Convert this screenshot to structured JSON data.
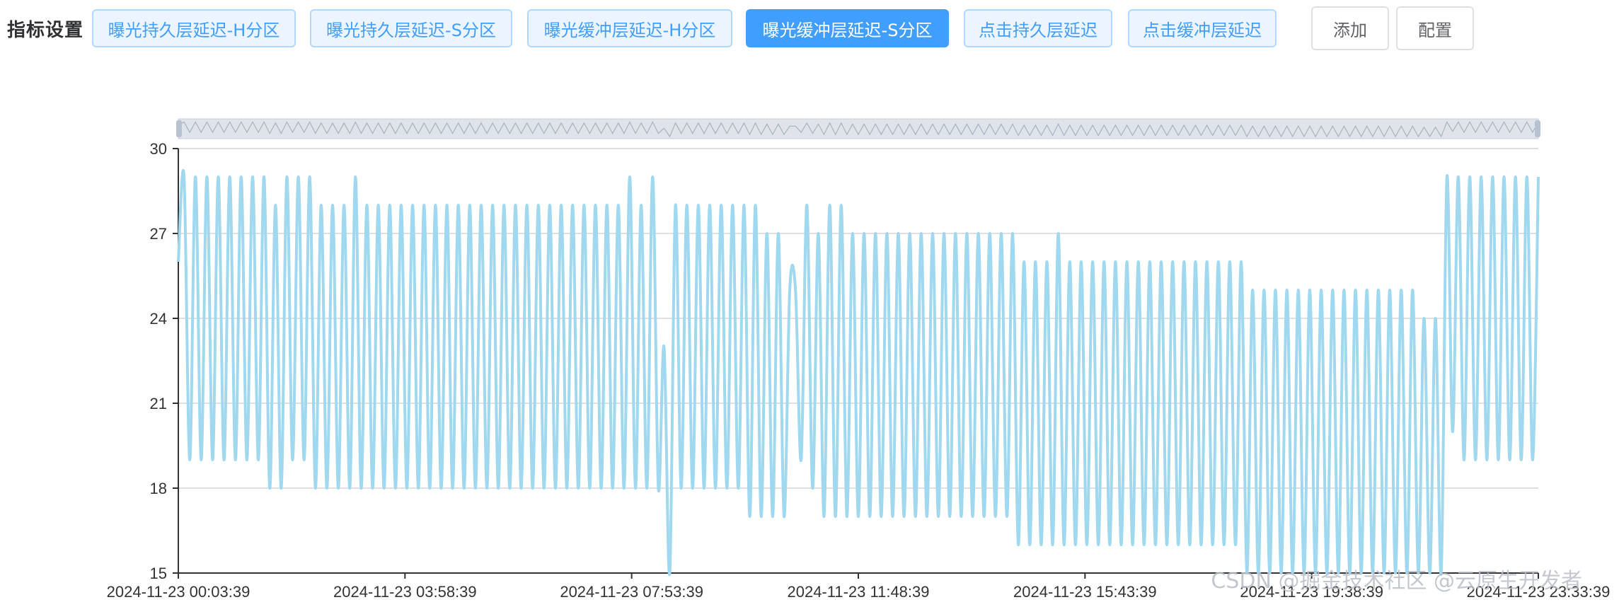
{
  "toolbar": {
    "label": "指标设置",
    "metric_buttons": [
      {
        "label": "曝光持久层延迟-H分区",
        "active": false
      },
      {
        "label": "曝光持久层延迟-S分区",
        "active": false
      },
      {
        "label": "曝光缓冲层延迟-H分区",
        "active": false
      },
      {
        "label": "曝光缓冲层延迟-S分区",
        "active": true
      },
      {
        "label": "点击持久层延迟",
        "active": false
      },
      {
        "label": "点击缓冲层延迟",
        "active": false
      }
    ],
    "add_label": "添加",
    "config_label": "配置"
  },
  "colors": {
    "accent": "#409eff",
    "series_line": "#9fd8ef",
    "grid": "#d3d6db",
    "axis": "#333333"
  },
  "watermark": "CSDN @掘金技术社区 @云原生开发者",
  "chart_data": {
    "type": "line",
    "title": "",
    "xlabel": "",
    "ylabel": "",
    "ylim": [
      15,
      30
    ],
    "yticks": [
      15,
      18,
      21,
      24,
      27,
      30
    ],
    "xticks": [
      "2024-11-23 00:03:39",
      "2024-11-23 03:58:39",
      "2024-11-23 07:53:39",
      "2024-11-23 11:48:39",
      "2024-11-23 15:43:39",
      "2024-11-23 19:38:39",
      "2024-11-23 23:33:39"
    ],
    "x_start": "2024-11-23 00:03:39",
    "x_end": "2024-11-23 23:33:39",
    "grid": true,
    "legend": "none",
    "datazoom_slider": true,
    "series": [
      {
        "values": [
          26,
          29,
          19,
          29,
          19,
          29,
          19,
          29,
          19,
          29,
          19,
          29,
          19,
          29,
          19,
          29,
          18,
          28,
          18,
          29,
          19,
          29,
          19,
          29,
          18,
          28,
          18,
          28,
          18,
          28,
          18,
          29,
          18,
          28,
          18,
          28,
          18,
          28,
          18,
          28,
          18,
          28,
          18,
          28,
          18,
          28,
          18,
          28,
          18,
          28,
          18,
          28,
          18,
          28,
          18,
          28,
          18,
          28,
          18,
          28,
          18,
          28,
          18,
          28,
          18,
          28,
          18,
          28,
          18,
          28,
          18,
          28,
          18,
          28,
          18,
          28,
          18,
          28,
          18,
          29,
          18,
          28,
          18,
          29,
          18,
          23,
          15,
          28,
          18,
          28,
          18,
          28,
          18,
          28,
          18,
          28,
          18,
          28,
          18,
          28,
          17,
          28,
          17,
          27,
          17,
          27,
          17,
          25,
          25,
          19,
          28,
          18,
          27,
          17,
          28,
          17,
          28,
          17,
          27,
          17,
          27,
          17,
          27,
          17,
          27,
          17,
          27,
          17,
          27,
          17,
          27,
          17,
          27,
          17,
          27,
          17,
          27,
          17,
          27,
          17,
          27,
          17,
          27,
          17,
          27,
          17,
          27,
          16,
          26,
          16,
          26,
          16,
          26,
          16,
          27,
          16,
          26,
          16,
          26,
          16,
          26,
          16,
          26,
          16,
          26,
          16,
          26,
          16,
          26,
          16,
          26,
          16,
          26,
          16,
          26,
          16,
          26,
          16,
          26,
          16,
          26,
          16,
          26,
          16,
          26,
          16,
          26,
          15,
          25,
          15,
          25,
          15,
          25,
          15,
          25,
          15,
          25,
          15,
          25,
          15,
          25,
          15,
          25,
          15,
          25,
          15,
          25,
          15,
          25,
          15,
          25,
          15,
          25,
          15,
          25,
          15,
          25,
          15,
          24,
          15,
          24,
          15,
          29,
          20,
          29,
          19,
          29,
          19,
          29,
          19,
          29,
          19,
          29,
          19,
          29,
          19,
          29,
          19,
          29
        ]
      }
    ]
  }
}
